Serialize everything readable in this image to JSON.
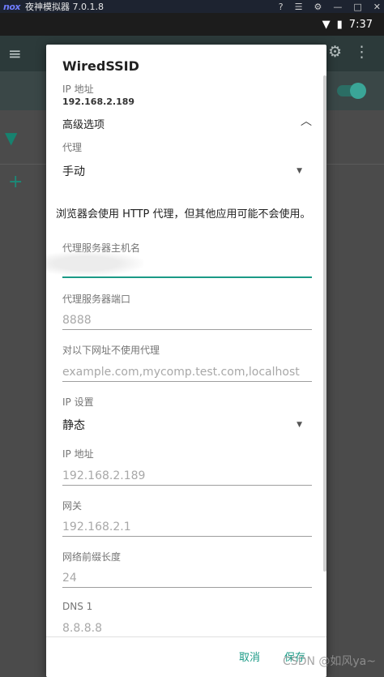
{
  "emulator": {
    "logo": "nox",
    "title": "夜神模拟器 7.0.1.8"
  },
  "status_bar": {
    "time": "7:37"
  },
  "dialog": {
    "title": "WiredSSID",
    "ip_label": "IP 地址",
    "ip_value": "192.168.2.189",
    "advanced_label": "高级选项",
    "proxy_label": "代理",
    "proxy_value": "手动",
    "warning": "浏览器会使用 HTTP 代理，但其他应用可能不会使用。",
    "proxy_host_label": "代理服务器主机名",
    "proxy_host_value": "",
    "proxy_port_label": "代理服务器端口",
    "proxy_port_placeholder": "8888",
    "bypass_label": "对以下网址不使用代理",
    "bypass_placeholder": "example.com,mycomp.test.com,localhost",
    "ip_settings_label": "IP 设置",
    "ip_settings_value": "静态",
    "static_ip_label": "IP 地址",
    "static_ip_placeholder": "192.168.2.189",
    "gateway_label": "网关",
    "gateway_placeholder": "192.168.2.1",
    "prefix_label": "网络前缀长度",
    "prefix_placeholder": "24",
    "dns1_label": "DNS 1",
    "dns1_placeholder": "8.8.8.8",
    "cancel_label": "取消",
    "save_label": "保存"
  },
  "watermark": "CSDN @如风ya~",
  "colors": {
    "accent": "#1b9a86",
    "dialog_bg": "#ffffff",
    "scrim": "#4b4b4b"
  }
}
